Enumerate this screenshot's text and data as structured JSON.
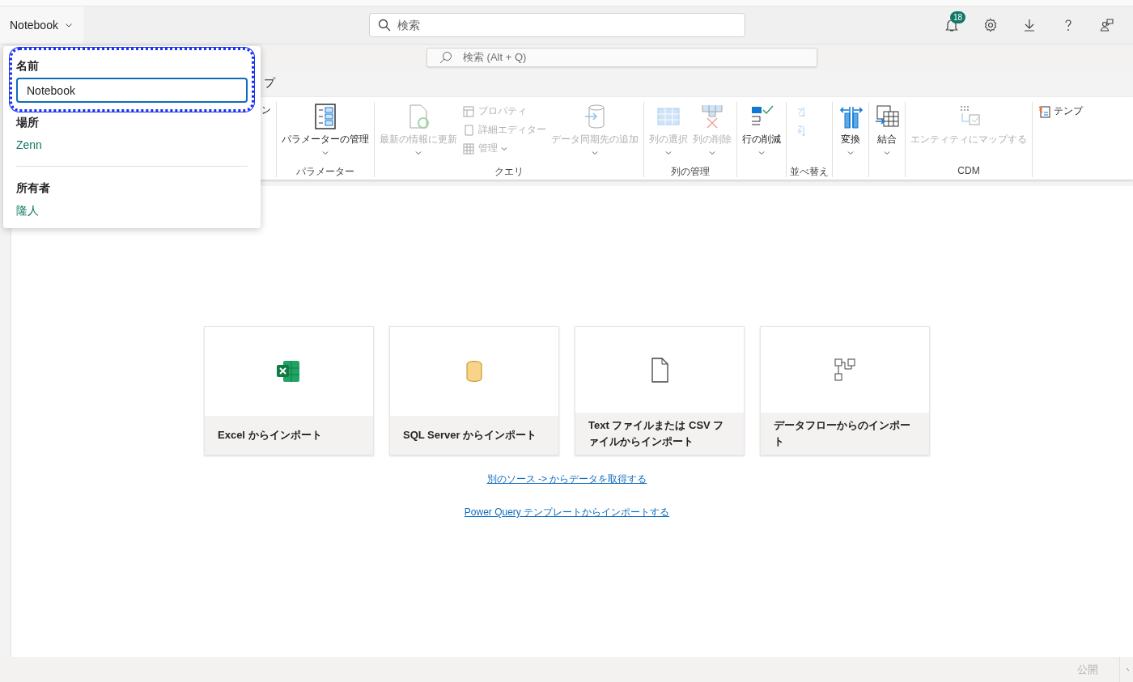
{
  "header": {
    "title": "Notebook",
    "search": {
      "placeholder": "検索"
    },
    "notifications": {
      "count": "18"
    }
  },
  "command_bar": {
    "search": {
      "placeholder": "検索 (Alt + Q)"
    }
  },
  "tabs": [
    {
      "label": "プ",
      "selected": false
    }
  ],
  "ribbon": {
    "groups": [
      {
        "buttons": [
          {
            "kind": "large",
            "label": "ン",
            "disabled": false,
            "dropdown": false
          }
        ]
      },
      {
        "label": "パラメーター",
        "buttons": [
          {
            "kind": "large",
            "label": "パラメーターの管理",
            "disabled": false,
            "dropdown": true
          }
        ]
      },
      {
        "label": "クエリ",
        "buttons": [
          {
            "kind": "large",
            "label": "最新の情報に更新",
            "disabled": true,
            "dropdown": true
          },
          {
            "kind": "small",
            "label": "プロパティ",
            "disabled": true,
            "dropdown": false
          },
          {
            "kind": "small",
            "label": "詳細エディター",
            "disabled": true,
            "dropdown": false
          },
          {
            "kind": "small",
            "label": "管理",
            "disabled": true,
            "dropdown": true
          },
          {
            "kind": "large",
            "label": "データ同期先の追加",
            "disabled": true,
            "dropdown": true
          }
        ]
      },
      {
        "label": "列の管理",
        "buttons": [
          {
            "kind": "large",
            "label": "列の選択",
            "disabled": true,
            "dropdown": true
          },
          {
            "kind": "large",
            "label": "列の削除",
            "disabled": true,
            "dropdown": true
          }
        ]
      },
      {
        "buttons": [
          {
            "kind": "large",
            "label": "行の削減",
            "disabled": false,
            "dropdown": true
          }
        ]
      },
      {
        "label": "並べ替え",
        "buttons": [
          {
            "kind": "icon",
            "disabled": true
          },
          {
            "kind": "icon",
            "disabled": true
          }
        ]
      },
      {
        "buttons": [
          {
            "kind": "large",
            "label": "変換",
            "disabled": false,
            "dropdown": true
          }
        ]
      },
      {
        "buttons": [
          {
            "kind": "large",
            "label": "結合",
            "disabled": false,
            "dropdown": true
          }
        ]
      },
      {
        "label": "CDM",
        "buttons": [
          {
            "kind": "large",
            "label": "エンティティにマップする",
            "disabled": true,
            "dropdown": false
          }
        ]
      },
      {
        "buttons": [
          {
            "kind": "small",
            "label": "テンプ",
            "disabled": false,
            "dropdown": false
          }
        ]
      }
    ]
  },
  "popup": {
    "name_label": "名前",
    "name_value": "Notebook",
    "location_label": "場所",
    "location": "Zenn",
    "owner_label": "所有者",
    "owner": "隆人"
  },
  "import_cards": [
    {
      "label": "Excel からインポート"
    },
    {
      "label": "SQL Server からインポート"
    },
    {
      "label": "Text ファイルまたは CSV ファイルからインポート"
    },
    {
      "label": "データフローからのインポート"
    }
  ],
  "links": [
    "別のソース -> からデータを取得する",
    "Power Query テンプレートからインポートする"
  ],
  "footer": {
    "publish": {
      "label": "公開",
      "disabled": true
    }
  }
}
